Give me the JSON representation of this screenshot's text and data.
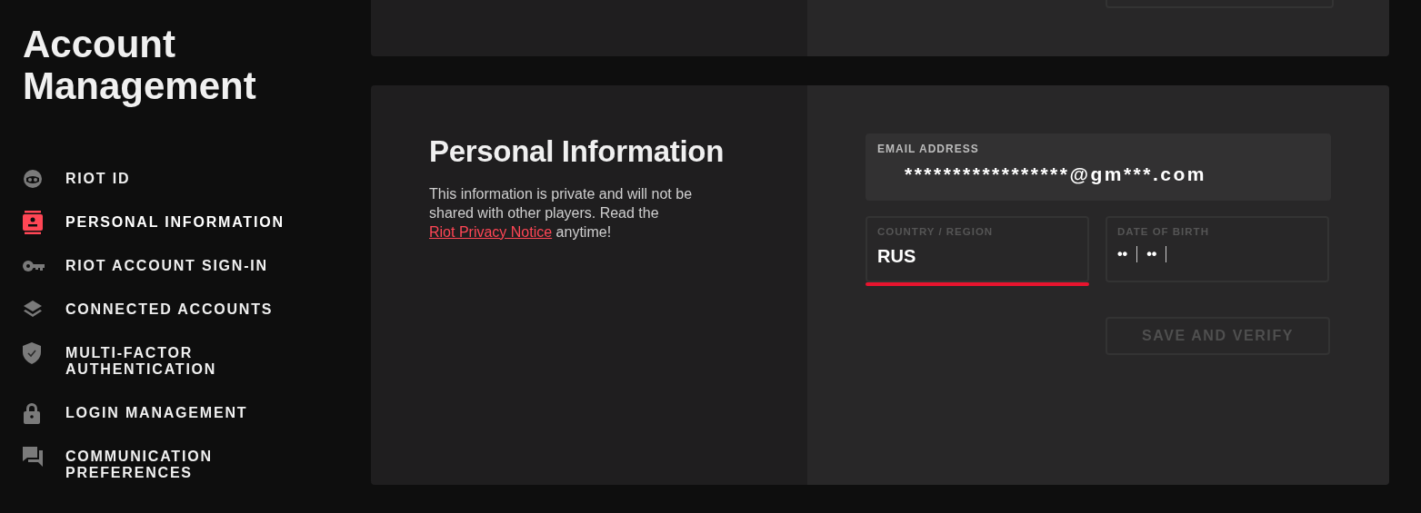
{
  "sidebar": {
    "title": "Account Management",
    "items": [
      {
        "label": "RIOT ID",
        "selected": false
      },
      {
        "label": "PERSONAL INFORMATION",
        "selected": true
      },
      {
        "label": "RIOT ACCOUNT SIGN-IN",
        "selected": false
      },
      {
        "label": "CONNECTED ACCOUNTS",
        "selected": false
      },
      {
        "label": "MULTI-FACTOR AUTHENTICATION",
        "selected": false
      },
      {
        "label": "LOGIN MANAGEMENT",
        "selected": false
      },
      {
        "label": "COMMUNICATION PREFERENCES",
        "selected": false
      }
    ]
  },
  "personal_information": {
    "title": "Personal Information",
    "description": "This information is private and will not be shared with other players. Read the ",
    "link": "Riot Privacy Notice",
    "description_end": " anytime!",
    "email": {
      "label": "EMAIL ADDRESS",
      "value": "*****************@gm***.com"
    },
    "country": {
      "label": "COUNTRY / REGION",
      "value": "RUS",
      "error": true
    },
    "date_of_birth": {
      "label": "DATE OF BIRTH",
      "parts": [
        "••",
        "••"
      ]
    },
    "save_button": {
      "label": "SAVE AND VERIFY",
      "disabled": true
    }
  }
}
